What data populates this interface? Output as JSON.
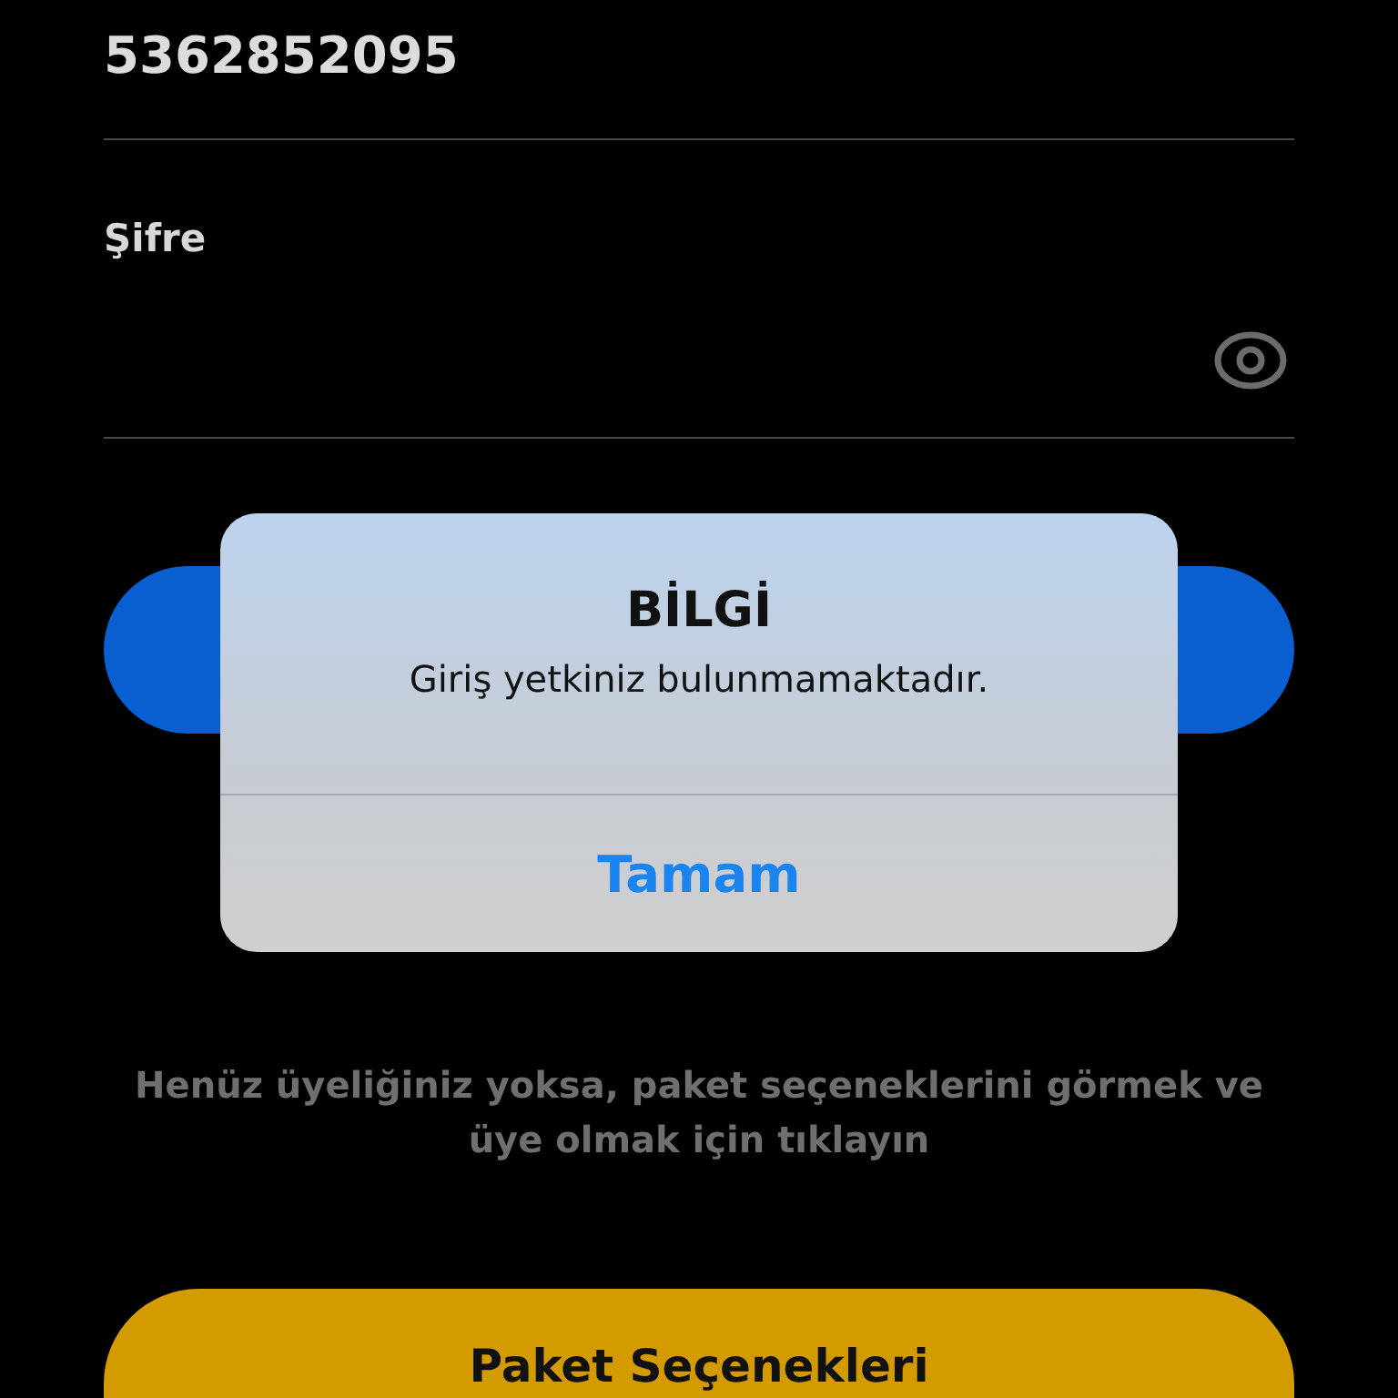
{
  "phone_field": {
    "value": "5362852095"
  },
  "password_field": {
    "label": "Şifre"
  },
  "hint": "Henüz üyeliğiniz yoksa, paket seçeneklerini görmek ve üye olmak için tıklayın",
  "packages_button": {
    "label": "Paket Seçenekleri"
  },
  "alert": {
    "title": "BİLGİ",
    "message": "Giriş yetkiniz bulunmamaktadır.",
    "buttons": [
      "Tamam"
    ]
  }
}
